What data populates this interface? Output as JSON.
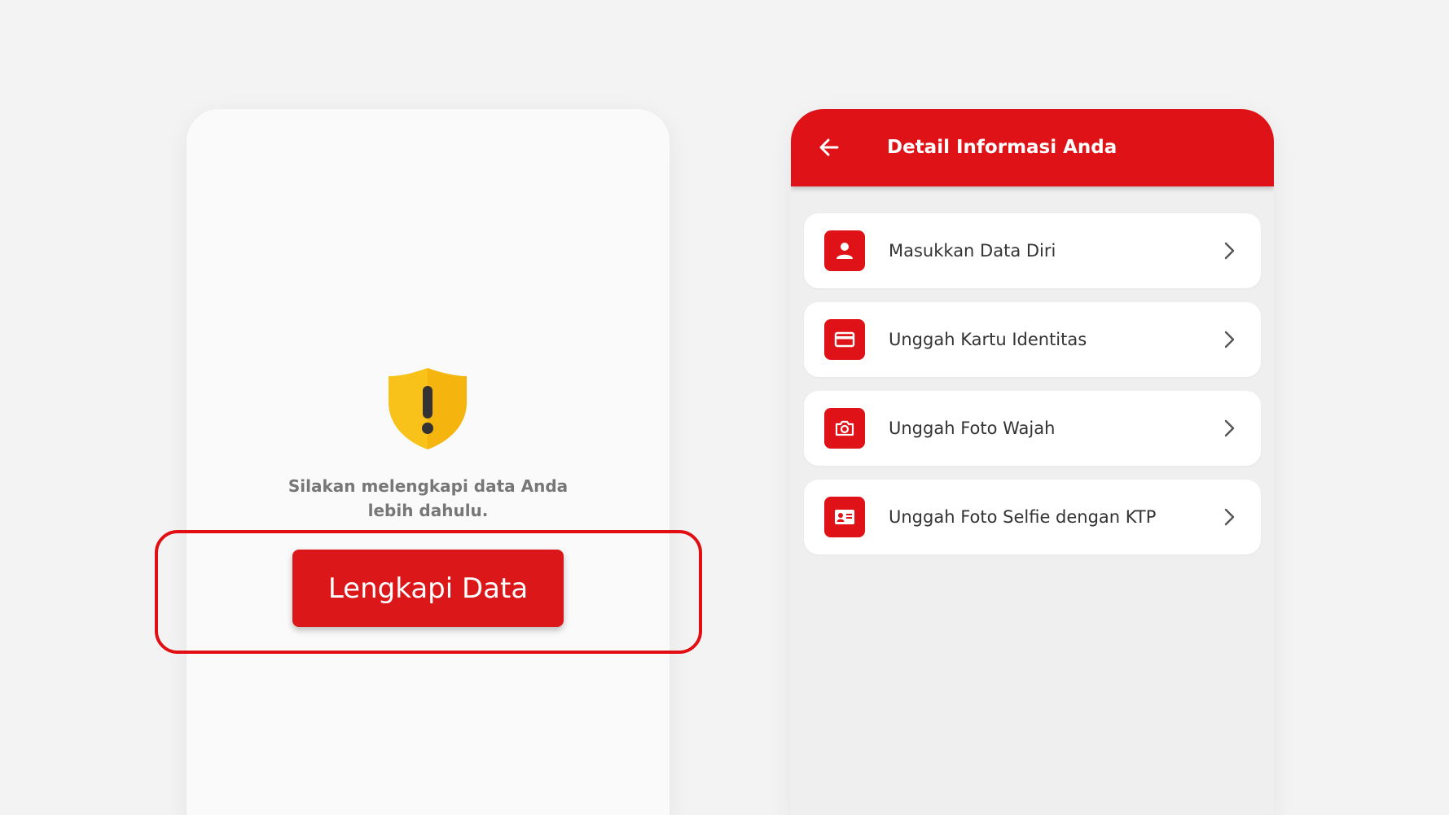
{
  "left_screen": {
    "notice_text": "Silakan melengkapi data Anda lebih dahulu.",
    "primary_button_label": "Lengkapi Data",
    "shield_icon": "warning-shield-icon"
  },
  "right_screen": {
    "header": {
      "title": "Detail Informasi Anda",
      "back_icon": "arrow-left-icon"
    },
    "menu_items": [
      {
        "label": "Masukkan Data Diri",
        "icon": "person-icon"
      },
      {
        "label": "Unggah Kartu Identitas",
        "icon": "card-icon"
      },
      {
        "label": "Unggah Foto Wajah",
        "icon": "camera-icon"
      },
      {
        "label": "Unggah Foto Selfie dengan KTP",
        "icon": "id-card-icon"
      }
    ]
  },
  "colors": {
    "brand_red": "#df1317",
    "highlight_red": "#e10f14",
    "shield_yellow": "#f9c21a",
    "background": "#f3f3f3"
  }
}
